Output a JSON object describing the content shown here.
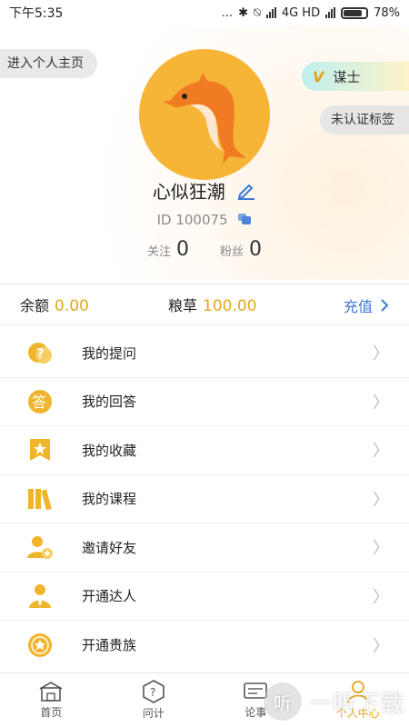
{
  "status_bar": {
    "time": "下午5:35",
    "dots": "...",
    "network": "4G HD",
    "battery": "78%"
  },
  "profile": {
    "home_link": "进入个人主页",
    "rank_icon": "V",
    "rank": "谋士",
    "tag": "未认证标签",
    "nickname": "心似狂潮",
    "id_text": "ID 100075",
    "follow_label": "关注",
    "follow_count": "0",
    "fans_label": "粉丝",
    "fans_count": "0"
  },
  "wallet": {
    "balance_label": "余额",
    "balance_value": "0.00",
    "grain_label": "粮草",
    "grain_value": "100.00",
    "recharge_label": "充值"
  },
  "menu": {
    "items": [
      {
        "label": "我的提问",
        "icon": "question-icon"
      },
      {
        "label": "我的回答",
        "icon": "answer-icon"
      },
      {
        "label": "我的收藏",
        "icon": "bookmark-star-icon"
      },
      {
        "label": "我的课程",
        "icon": "books-icon"
      },
      {
        "label": "邀请好友",
        "icon": "invite-user-icon"
      },
      {
        "label": "开通达人",
        "icon": "expert-icon"
      },
      {
        "label": "开通贵族",
        "icon": "noble-medal-icon"
      }
    ]
  },
  "tabbar": {
    "tabs": [
      {
        "label": "首页",
        "icon": "home-icon"
      },
      {
        "label": "问计",
        "icon": "ask-icon"
      },
      {
        "label": "论事",
        "icon": "discuss-icon"
      },
      {
        "label": "个人中心",
        "icon": "profile-icon"
      }
    ]
  },
  "watermark": {
    "glyph": "听",
    "text": "一听下载"
  },
  "colors": {
    "accent": "#e6a619",
    "link": "#3d79d2",
    "avatar_bg": "#f7b538"
  }
}
